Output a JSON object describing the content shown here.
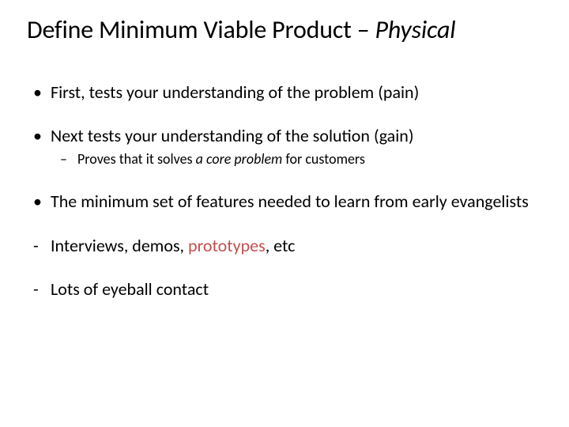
{
  "title": {
    "main": "Define Minimum Viable Product – ",
    "italic": "Physical"
  },
  "bullets": {
    "b1": "First, tests your understanding of the problem (pain)",
    "b2": "Next tests your understanding of the solution (gain)",
    "b2sub_pre": "Proves that it solves ",
    "b2sub_em": "a core problem",
    "b2sub_post": " for customers",
    "b3": "The minimum set of features needed to learn from early evangelists",
    "b4_pre": "Interviews, demos, ",
    "b4_accent": "prototypes",
    "b4_post": ", etc",
    "b5": "Lots of eyeball contact"
  }
}
